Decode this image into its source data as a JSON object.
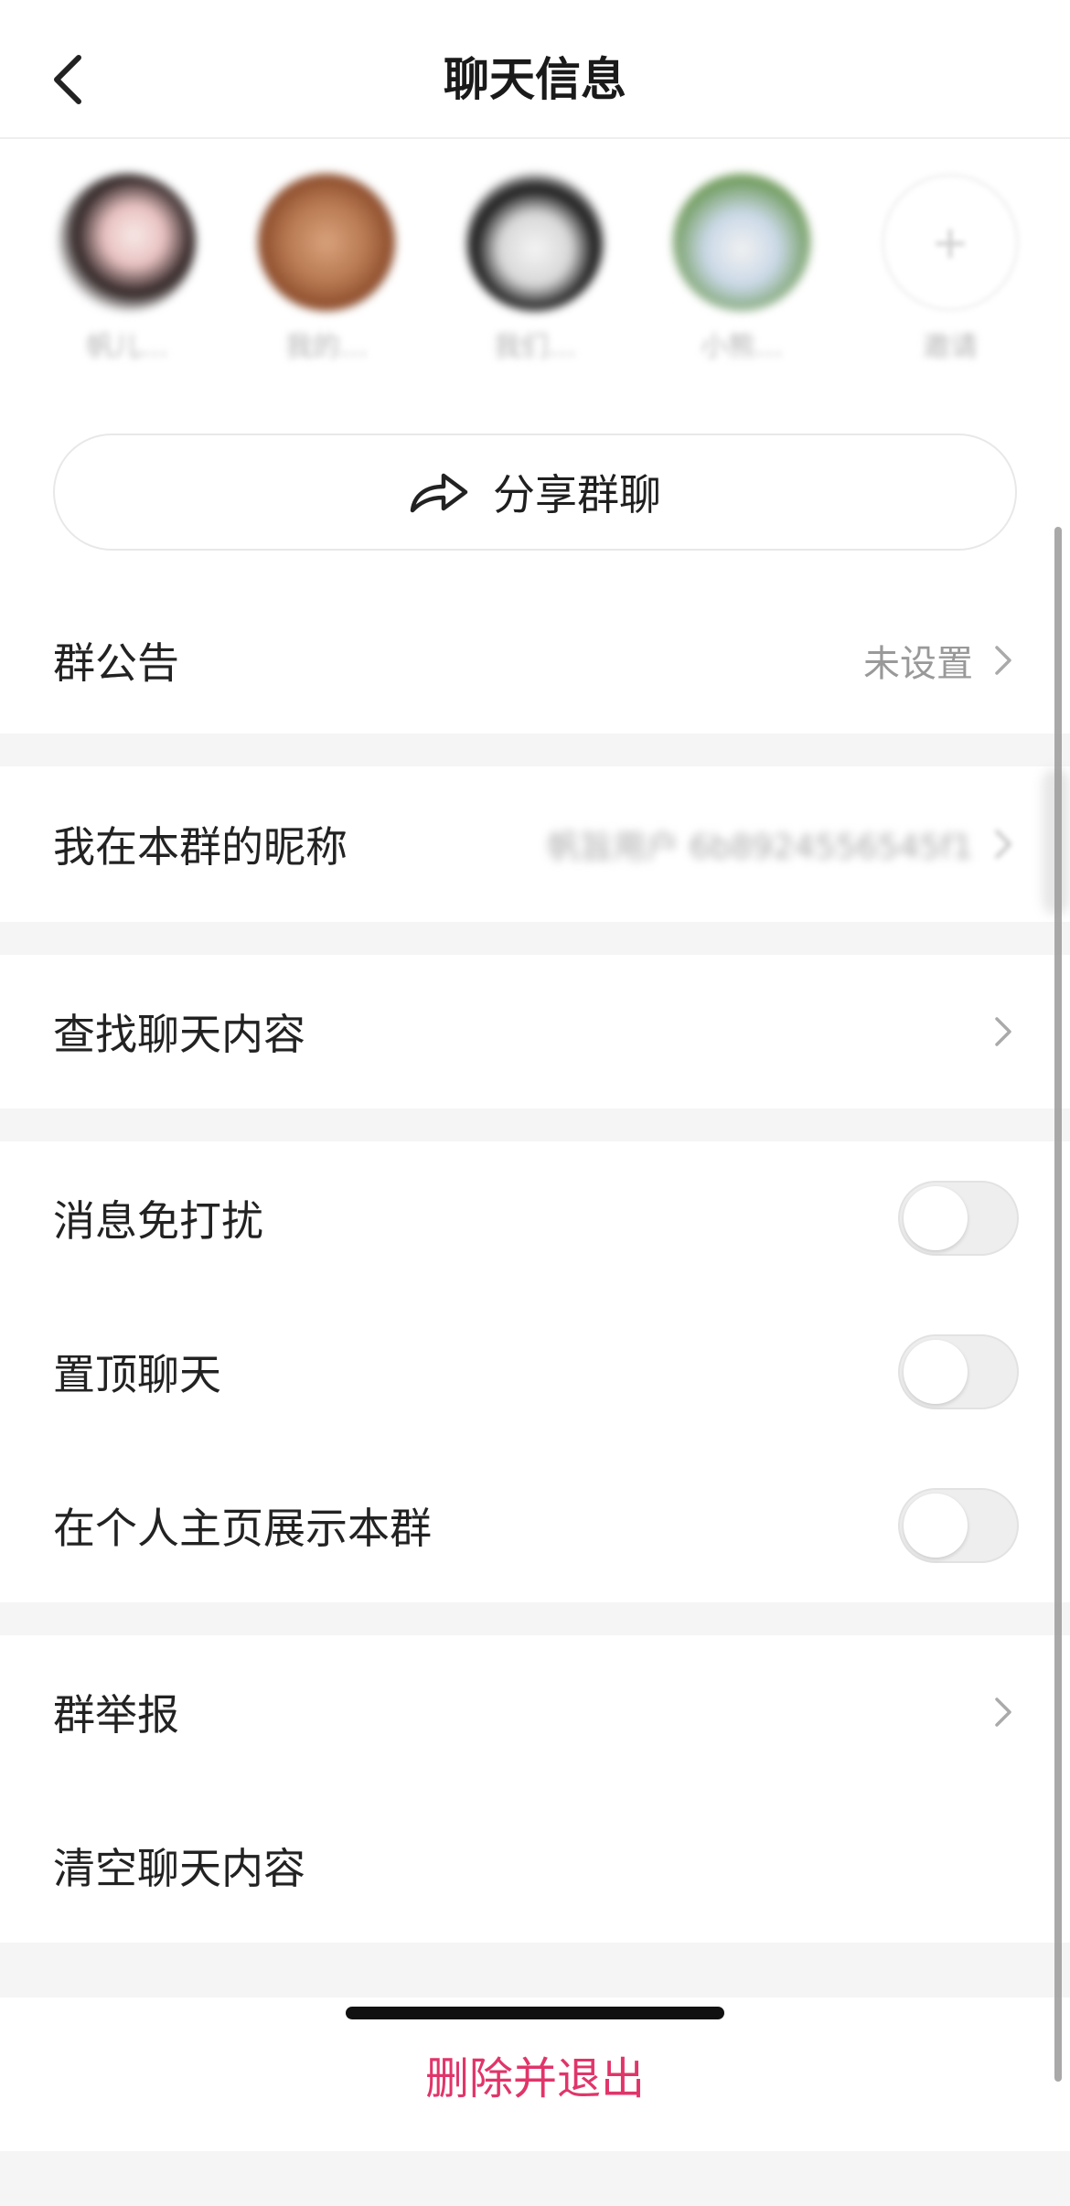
{
  "header": {
    "title": "聊天信息"
  },
  "members": [
    {
      "name": "帆儿…",
      "avatar_colors": [
        "#2a1f1f",
        "#e9c2c2",
        "#f7e9e6"
      ]
    },
    {
      "name": "我的…",
      "avatar_colors": [
        "#8a4a2a",
        "#b87a52",
        "#d9a27b"
      ]
    },
    {
      "name": "我们…",
      "avatar_colors": [
        "#111111",
        "#f4f4f4",
        "#d8d8d8"
      ]
    },
    {
      "name": "小熊…",
      "avatar_colors": [
        "#6e9a5a",
        "#cbd9e8",
        "#f1f1f1"
      ]
    }
  ],
  "invite": {
    "label": "邀请"
  },
  "share": {
    "label": "分享群聊"
  },
  "announcement": {
    "label": "群公告",
    "value": "未设置"
  },
  "nickname": {
    "label": "我在本群的昵称",
    "value": "帆旨用户 6b8924556545f1"
  },
  "search_chat": {
    "label": "查找聊天内容"
  },
  "toggles": {
    "mute": {
      "label": "消息免打扰",
      "on": false
    },
    "pin": {
      "label": "置顶聊天",
      "on": false
    },
    "show_on_profile": {
      "label": "在个人主页展示本群",
      "on": false
    }
  },
  "report": {
    "label": "群举报"
  },
  "clear": {
    "label": "清空聊天内容"
  },
  "exit": {
    "label": "删除并退出"
  },
  "colors": {
    "danger": "#e0356a",
    "separator": "#f5f5f5",
    "secondary_text": "#999999"
  }
}
